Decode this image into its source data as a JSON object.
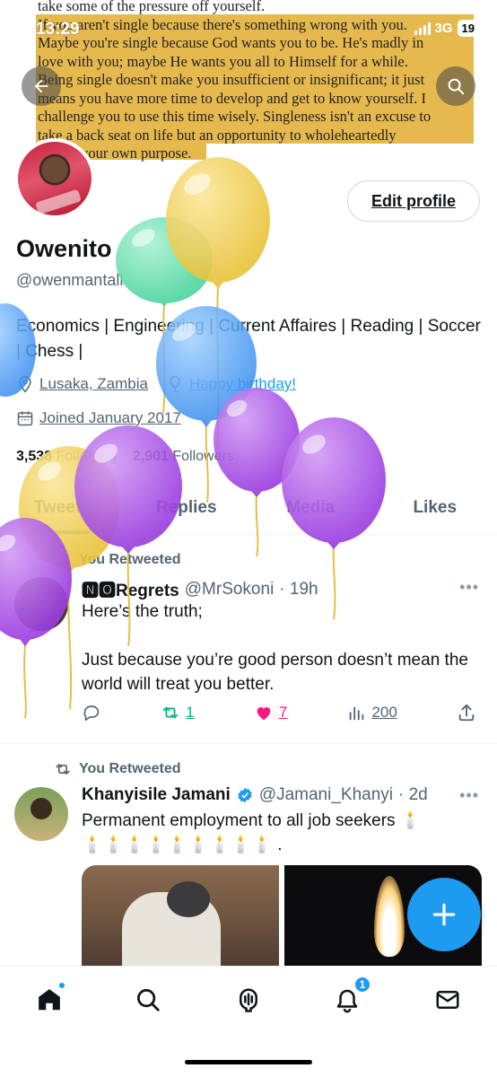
{
  "status_bar": {
    "time": "13:29",
    "network": "3G",
    "battery": "19"
  },
  "banner": {
    "lines": [
      "take some of the pressure off yourself.",
      "If you aren't single because there's something wrong with you.",
      "Maybe you're single because God wants you to be. He's madly in",
      "love with you; maybe He wants you all to Himself for a while.",
      "Being single doesn't make you insufficient or insignificant; it just",
      "means you have more time to develop and get to know yourself. I",
      "challenge you to use this time wisely. Singleness isn't an excuse to",
      "take a back seat on life but an opportunity to wholeheartedly",
      "pursue your own purpose."
    ]
  },
  "header": {
    "back_icon": "back-arrow-icon",
    "search_icon": "search-icon"
  },
  "profile": {
    "edit_label": "Edit profile",
    "name": "Owenito",
    "handle": "@owenmantall",
    "bio": "Economics | Engineering | Current Affaires | Reading | Soccer | Chess |",
    "location": "Lusaka, Zambia",
    "birthday": "Happy birthday!",
    "joined": "Joined January 2017",
    "following_count": "3,538",
    "following_label": "Following",
    "followers_count": "2,901",
    "followers_label": "Followers"
  },
  "tabs": [
    "Tweets",
    "Replies",
    "Media",
    "Likes"
  ],
  "tweets": [
    {
      "retweet_label": "You Retweeted",
      "name": "🅽🅾Regrets",
      "handle": "@MrSokoni",
      "time": "· 19h",
      "text_1": "Here’s the truth;",
      "text_2": "Just because you’re good person doesn’t mean the world will treat you better.",
      "replies": "",
      "retweets": "1",
      "likes": "7",
      "views": "200"
    },
    {
      "retweet_label": "You Retweeted",
      "name": "Khanyisile Jamani",
      "handle": "@Jamani_Khanyi",
      "time": "· 2d",
      "text_1": "Permanent employment to all job seekers 🕯️",
      "text_2": "🕯️🕯️🕯️🕯️🕯️🕯️🕯️🕯️🕯️ ."
    }
  ],
  "more_label": "•••",
  "notifications_badge": "1",
  "colors": {
    "accent": "#1d9bf0",
    "like": "#f91880",
    "retweet": "#00ba7c",
    "banner_highlight": "#e6b94f"
  }
}
